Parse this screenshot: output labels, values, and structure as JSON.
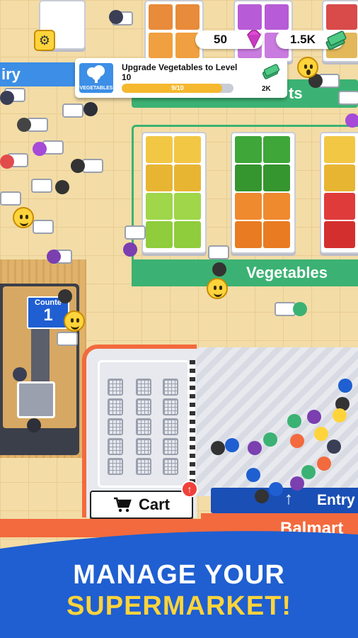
{
  "hud": {
    "gems": "50",
    "cash": "1.5K"
  },
  "quest": {
    "icon_label": "VEGETABLES",
    "title": "Upgrade Vegetables to Level 10",
    "progress_text": "9/10",
    "progress_fraction": 0.9,
    "reward": "2K"
  },
  "sections": {
    "dairy_fragment": "iry",
    "fruits_fragment": "ts",
    "vegetables": "Vegetables"
  },
  "counter": {
    "label": "Counte",
    "number": "1"
  },
  "cart_button": {
    "label": "Cart",
    "badge_icon": "up-arrow-icon"
  },
  "entry_sign": {
    "label": "Entry",
    "icon": "up-arrow-icon"
  },
  "store_sign": "Balmart",
  "banner": {
    "line1": "MANAGE YOUR",
    "line2": "SUPERMARKET!"
  },
  "colors": {
    "accent_green": "#3bb273",
    "banner_blue": "#1f5fd1",
    "banner_yellow": "#ffd43b",
    "sign_orange": "#f26a3d",
    "entry_blue": "#1a4fb5"
  }
}
